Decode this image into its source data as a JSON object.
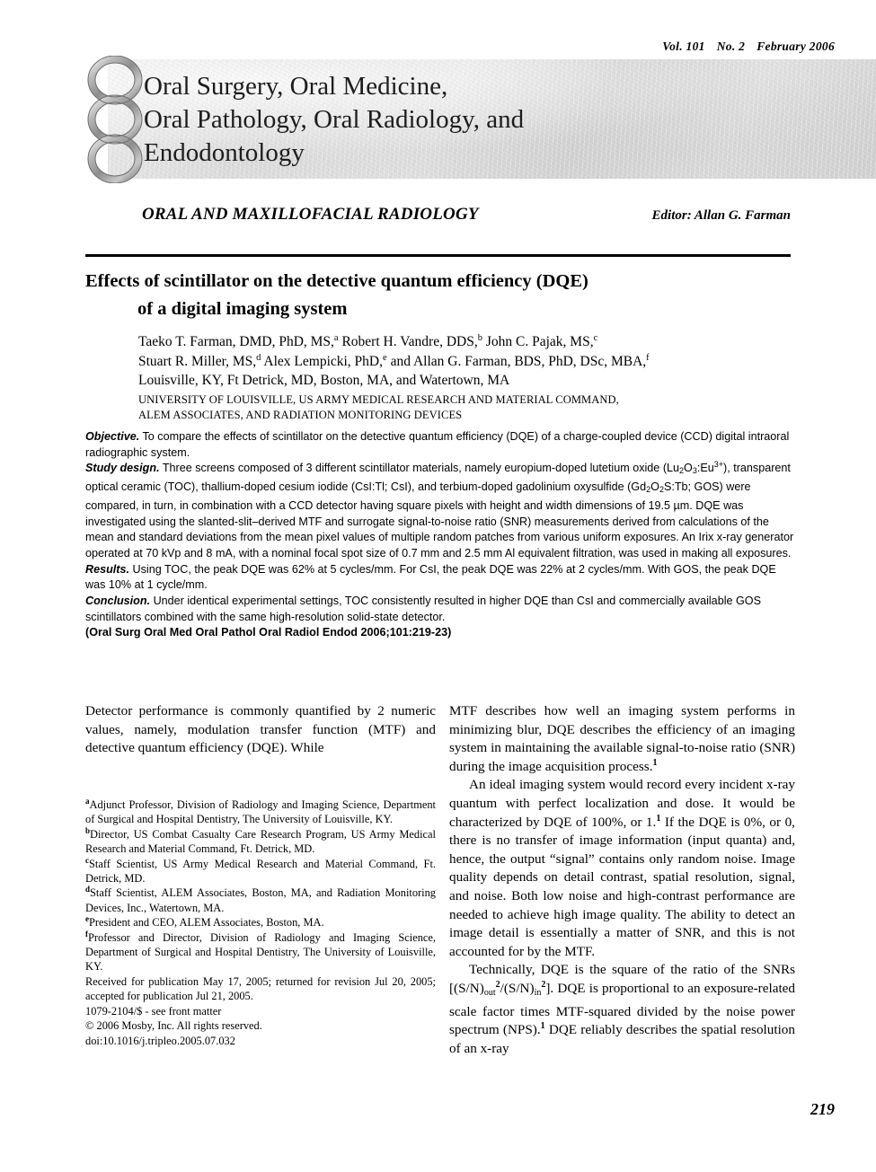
{
  "issue": {
    "volume": "Vol. 101",
    "number": "No. 2",
    "date": "February 2006"
  },
  "masthead": {
    "line1": "Oral Surgery, Oral Medicine,",
    "line2": "Oral Pathology, Oral Radiology, and",
    "line3": "Endodontology",
    "logo_name": "three-interlocking-rings-logo"
  },
  "section": {
    "title": "ORAL AND MAXILLOFACIAL RADIOLOGY",
    "editor": "Editor: Allan G. Farman"
  },
  "article": {
    "title_line1": "Effects of scintillator on the detective quantum efficiency (DQE)",
    "title_line2": "of a digital imaging system",
    "authors_line1_a": "Taeko T. Farman, DMD, PhD, MS,",
    "authors_line1_sup_a": "a",
    "authors_line1_b": " Robert H. Vandre, DDS,",
    "authors_line1_sup_b": "b",
    "authors_line1_c": " John C. Pajak, MS,",
    "authors_line1_sup_c": "c",
    "authors_line2_a": "Stuart R. Miller, MS,",
    "authors_line2_sup_d": "d",
    "authors_line2_b": " Alex Lempicki, PhD,",
    "authors_line2_sup_e": "e",
    "authors_line2_c": " and Allan G. Farman, BDS, PhD, DSc, MBA,",
    "authors_line2_sup_f": "f",
    "authors_line3": "Louisville, KY, Ft Detrick, MD, Boston, MA, and Watertown, MA",
    "affiliation_line1": "UNIVERSITY OF LOUISVILLE, US ARMY MEDICAL RESEARCH AND MATERIAL COMMAND,",
    "affiliation_line2": "ALEM ASSOCIATES, AND RADIATION MONITORING DEVICES"
  },
  "abstract": {
    "objective_label": "Objective.",
    "objective_text": " To compare the effects of scintillator on the detective quantum efficiency (DQE) of a charge-coupled device (CCD) digital intraoral radiographic system.",
    "study_design_label": "Study design.",
    "study_design_p1": " Three screens composed of 3 different scintillator materials, namely europium-doped lutetium oxide (Lu",
    "study_design_sub1": "2",
    "study_design_p2": "O",
    "study_design_sub2": "3",
    "study_design_p3": ":Eu",
    "study_design_sup1": "3+",
    "study_design_p4": "), transparent optical ceramic (TOC), thallium-doped cesium iodide (CsI:Tl; CsI), and terbium-doped gadolinium oxysulfide (Gd",
    "study_design_sub3": "2",
    "study_design_p5": "O",
    "study_design_sub4": "2",
    "study_design_p6": "S:Tb; GOS) were compared, in turn, in combination with a CCD detector having square pixels with height and width dimensions of 19.5 µm. DQE was investigated using the slanted-slit–derived MTF and surrogate signal-to-noise ratio (SNR) measurements derived from calculations of the mean and standard deviations from the mean pixel values of multiple random patches from various uniform exposures. An Irix x-ray generator operated at 70 kVp and 8 mA, with a nominal focal spot size of 0.7 mm and 2.5 mm Al equivalent filtration, was used in making all exposures.",
    "results_label": "Results.",
    "results_text": " Using TOC, the peak DQE was 62% at 5 cycles/mm. For CsI, the peak DQE was 22% at 2 cycles/mm. With GOS, the peak DQE was 10% at 1 cycle/mm.",
    "conclusion_label": "Conclusion.",
    "conclusion_text": " Under identical experimental settings, TOC consistently resulted in higher DQE than CsI and commercially available GOS scintillators combined with the same high-resolution solid-state detector.",
    "citation": "(Oral Surg Oral Med Oral Pathol Oral Radiol Endod 2006;101:219-23)"
  },
  "body": {
    "left_para1": "Detector performance is commonly quantified by 2 numeric values, namely, modulation transfer function (MTF) and detective quantum efficiency (DQE). While",
    "right_para1_a": "MTF describes how well an imaging system performs in minimizing blur, DQE describes the efficiency of an imaging system in maintaining the available signal-to-noise ratio (SNR) during the image acquisition process.",
    "right_para1_sup": "1",
    "right_para2_a": "An ideal imaging system would record every incident x-ray quantum with perfect localization and dose. It would be characterized by DQE of 100%, or 1.",
    "right_para2_sup": "1",
    "right_para2_b": " If the DQE is 0%, or 0, there is no transfer of image information (input quanta) and, hence, the output “signal” contains only random noise. Image quality depends on detail contrast, spatial resolution, signal, and noise. Both low noise and high-contrast performance are needed to achieve high image quality. The ability to detect an image detail is essentially a matter of SNR, and this is not accounted for by the MTF.",
    "right_para3_a": "Technically, DQE is the square of the ratio of the SNRs [(S/N)",
    "right_para3_sub1": "out",
    "right_para3_sup1": "2",
    "right_para3_b": "/(S/N)",
    "right_para3_sub2": "in",
    "right_para3_sup2": "2",
    "right_para3_c": "]. DQE is proportional to an exposure-related scale factor times MTF-squared divided by the noise power spectrum (NPS).",
    "right_para3_sup3": "1",
    "right_para3_d": " DQE reliably describes the spatial resolution of an x-ray"
  },
  "footnotes": {
    "a_sup": "a",
    "a_text": "Adjunct Professor, Division of Radiology and Imaging Science, Department of Surgical and Hospital Dentistry, The University of Louisville, KY.",
    "b_sup": "b",
    "b_text": "Director, US Combat Casualty Care Research Program, US Army Medical Research and Material Command, Ft. Detrick, MD.",
    "c_sup": "c",
    "c_text": "Staff Scientist, US Army Medical Research and Material Command, Ft. Detrick, MD.",
    "d_sup": "d",
    "d_text": "Staff Scientist, ALEM Associates, Boston, MA, and Radiation Monitoring Devices, Inc., Watertown, MA.",
    "e_sup": "e",
    "e_text": "President and CEO, ALEM Associates, Boston, MA.",
    "f_sup": "f",
    "f_text": "Professor and Director, Division of Radiology and Imaging Science, Department of Surgical and Hospital Dentistry, The University of Louisville, KY.",
    "received": "Received for publication May 17, 2005; returned for revision Jul 20, 2005; accepted for publication Jul 21, 2005.",
    "issn": "1079-2104/$ - see front matter",
    "copyright": "© 2006 Mosby, Inc. All rights reserved.",
    "doi": "doi:10.1016/j.tripleo.2005.07.032"
  },
  "folio": {
    "page_number": "219"
  },
  "colors": {
    "text": "#000000",
    "masthead_bg": "#dedede",
    "ring_gray": "#9a9a9a"
  }
}
